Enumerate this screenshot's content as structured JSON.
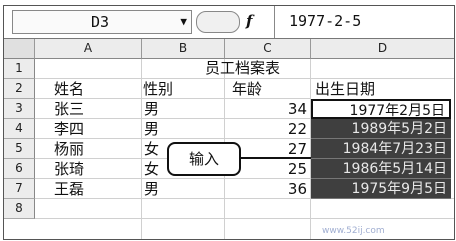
{
  "formula_bar": {
    "cell_ref": "D3",
    "value": "1977-2-5"
  },
  "columns": [
    "A",
    "B",
    "C",
    "D"
  ],
  "rows": [
    "1",
    "2",
    "3",
    "4",
    "5",
    "6",
    "7",
    "8"
  ],
  "sheet": {
    "title": "员工档案表",
    "headers": {
      "name": "姓名",
      "gender": "性别",
      "age": "年龄",
      "birth": "出生日期"
    },
    "records": [
      {
        "name": "张三",
        "gender": "男",
        "age": "34",
        "birth": "1977年2月5日"
      },
      {
        "name": "李四",
        "gender": "男",
        "age": "22",
        "birth": "1989年5月2日"
      },
      {
        "name": "杨丽",
        "gender": "女",
        "age": "27",
        "birth": "1984年7月23日"
      },
      {
        "name": "张琦",
        "gender": "女",
        "age": "25",
        "birth": "1986年5月14日"
      },
      {
        "name": "王磊",
        "gender": "男",
        "age": "36",
        "birth": "1975年9月5日"
      }
    ]
  },
  "callout": {
    "label": "输入"
  },
  "watermark": {
    "url": "www.52ij.com"
  },
  "colors": {
    "selection": "#3f3f3f",
    "header_bg": "#ececec"
  }
}
